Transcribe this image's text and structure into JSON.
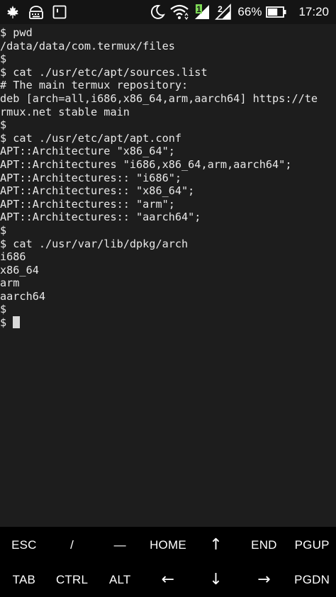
{
  "statusbar": {
    "battery_percent": "66%",
    "time": "17:20",
    "sim1_label": "1",
    "sim2_label": "2",
    "left_icons": [
      "maple-leaf-icon",
      "keyboard-icon",
      "terminal-notification-icon"
    ],
    "right_icons": [
      "moon-icon",
      "wifi-icon",
      "signal-sim1-icon",
      "signal-sim2-icon",
      "battery-icon"
    ]
  },
  "terminal": {
    "lines": [
      "$ pwd",
      "/data/data/com.termux/files",
      "$",
      "$ cat ./usr/etc/apt/sources.list",
      "# The main termux repository:",
      "deb [arch=all,i686,x86_64,arm,aarch64] https://te",
      "rmux.net stable main",
      "$",
      "$ cat ./usr/etc/apt/apt.conf",
      "APT::Architecture \"x86_64\";",
      "APT::Architectures \"i686,x86_64,arm,aarch64\";",
      "APT::Architectures:: \"i686\";",
      "APT::Architectures:: \"x86_64\";",
      "APT::Architectures:: \"arm\";",
      "APT::Architectures:: \"aarch64\";",
      "$",
      "$ cat ./usr/var/lib/dpkg/arch",
      "i686",
      "x86_64",
      "arm",
      "aarch64",
      "$"
    ],
    "prompt": "$ "
  },
  "extrakeys": {
    "row1": [
      {
        "label": "ESC",
        "name": "key-esc"
      },
      {
        "label": "/",
        "name": "key-slash"
      },
      {
        "label": "—",
        "name": "key-dash"
      },
      {
        "label": "HOME",
        "name": "key-home"
      },
      {
        "label": "↑",
        "name": "key-arrow-up"
      },
      {
        "label": "END",
        "name": "key-end"
      },
      {
        "label": "PGUP",
        "name": "key-pgup"
      }
    ],
    "row2": [
      {
        "label": "TAB",
        "name": "key-tab"
      },
      {
        "label": "CTRL",
        "name": "key-ctrl"
      },
      {
        "label": "ALT",
        "name": "key-alt"
      },
      {
        "label": "←",
        "name": "key-arrow-left"
      },
      {
        "label": "↓",
        "name": "key-arrow-down"
      },
      {
        "label": "→",
        "name": "key-arrow-right"
      },
      {
        "label": "PGDN",
        "name": "key-pgdn"
      }
    ]
  },
  "colors": {
    "terminal_bg": "#1d1d1d",
    "terminal_fg": "#e8e8e8",
    "keys_bg": "#000000",
    "sim1_accent": "#7ed957"
  }
}
